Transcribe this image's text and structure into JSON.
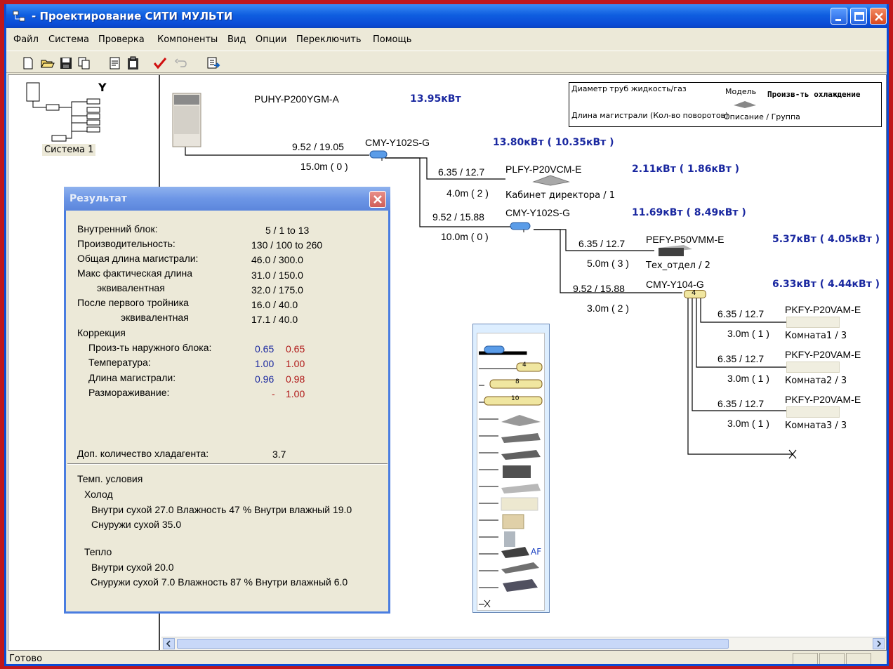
{
  "window": {
    "title": "- Проектирование СИТИ МУЛЬТИ",
    "title_color": "#0a4bd6"
  },
  "menu": [
    "Файл",
    "Система",
    "Проверка",
    "Компоненты",
    "Вид",
    "Опции",
    "Переключить",
    "Помощь"
  ],
  "toolbar": {
    "icons": [
      "new-file-icon",
      "open-folder-icon",
      "save-icon",
      "copy-icon",
      "print-preview-icon",
      "clipboard-icon",
      "check-icon",
      "undo-icon",
      "export-icon"
    ]
  },
  "tree": {
    "header": "Y",
    "system_label": "Система 1"
  },
  "legend": {
    "pipe_diameter": "Диаметр труб жидкость/газ",
    "model": "Модель",
    "cooling_capacity": "Произв-ть охлаждение",
    "pipe_length": "Длина магистрали (Кол-во поворотов)",
    "description": "Описание / Группа"
  },
  "diagram": {
    "outdoor": {
      "model": "PUHY-P200YGM-A",
      "capacity": "13.95кВт"
    },
    "branch1": {
      "model": "CMY-Y102S-G",
      "capacity": "13.80кВт ( 10.35кВт )",
      "pipe": "9.52 / 19.05",
      "length": "15.0m ( 0 )"
    },
    "unit1": {
      "model": "PLFY-P20VCM-E",
      "capacity": "2.11кВт ( 1.86кВт )",
      "pipe": "6.35 / 12.7",
      "length": "4.0m ( 2 )",
      "description": "Кабинет директора / 1"
    },
    "branch2": {
      "model": "CMY-Y102S-G",
      "capacity": "11.69кВт ( 8.49кВт )",
      "pipe": "9.52 / 15.88",
      "length": "10.0m ( 0 )"
    },
    "unit2": {
      "model": "PEFY-P50VMM-E",
      "capacity": "5.37кВт ( 4.05кВт )",
      "pipe": "6.35 / 12.7",
      "length": "5.0m ( 3 )",
      "description": "Тех_отдел / 2"
    },
    "header1": {
      "model": "CMY-Y104-G",
      "capacity": "6.33кВт ( 4.44кВт )",
      "pipe": "9.52 / 15.88",
      "length": "3.0m ( 2 )",
      "label": "4"
    },
    "units": [
      {
        "model": "PKFY-P20VAM-E",
        "pipe": "6.35 / 12.7",
        "length": "3.0m ( 1 )",
        "description": "Комната1 / 3"
      },
      {
        "model": "PKFY-P20VAM-E",
        "pipe": "6.35 / 12.7",
        "length": "3.0m ( 1 )",
        "description": "Комната2 / 3"
      },
      {
        "model": "PKFY-P20VAM-E",
        "pipe": "6.35 / 12.7",
        "length": "3.0m ( 1 )",
        "description": "Комната3 / 3"
      }
    ]
  },
  "palette": {
    "labels": [
      "4",
      "8",
      "10",
      "AF"
    ]
  },
  "result": {
    "title": "Результат",
    "rows": [
      {
        "label": "Внутренний блок:",
        "value": "5  /  1 to 13"
      },
      {
        "label": "Производительность:",
        "value": "130  /  100 to 260"
      },
      {
        "label": "Общая длина магистрали:",
        "value": "46.0  /  300.0"
      },
      {
        "label": "Макс фактическая длина",
        "value": "31.0  /  150.0"
      },
      {
        "label": "эквивалентная",
        "value": "32.0  /  175.0"
      },
      {
        "label": "После первого тройника",
        "value": "16.0  /  40.0"
      },
      {
        "label": "эквивалентная",
        "value": "17.1  /  40.0"
      }
    ],
    "correction": {
      "header": "Коррекция",
      "rows": [
        {
          "label": "Произ-ть наружного блока:",
          "v1": "0.65",
          "v2": "0.65"
        },
        {
          "label": "Температура:",
          "v1": "1.00",
          "v2": "1.00"
        },
        {
          "label": "Длина магистрали:",
          "v1": "0.96",
          "v2": "0.98"
        },
        {
          "label": "Размораживание:",
          "v1": "-",
          "v2": "1.00"
        }
      ]
    },
    "refrigerant": {
      "label": "Доп. количество хладагента:",
      "value": "3.7"
    },
    "temp": {
      "header": "Темп. условия",
      "cool": {
        "header": "Холод",
        "inside": "Внутри сухой   27.0 Влажность  47 %  Внутри влажный  19.0",
        "outside": "Снуружи сухой   35.0"
      },
      "heat": {
        "header": "Тепло",
        "inside": "Внутри сухой     20.0",
        "outside": "Снуружи сухой     7.0 Влажность  87 %  Внутри влажный      6.0"
      }
    }
  },
  "status": "Готово"
}
